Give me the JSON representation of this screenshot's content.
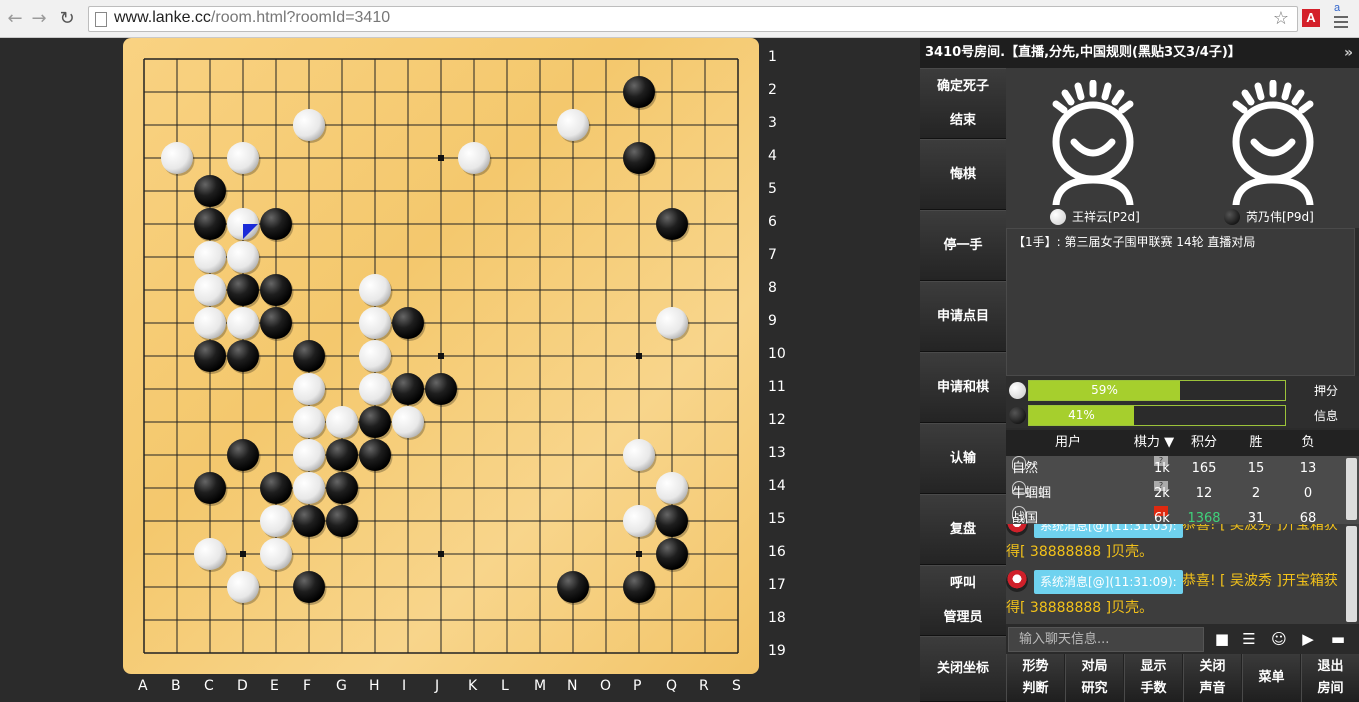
{
  "browser": {
    "url_host": "www.lanke.cc",
    "url_path": "/room.html?roomId=3410"
  },
  "room_title": "3410号房间.【直播,分先,中国规则(黑贴3又3/4子)】",
  "board": {
    "size": 19,
    "columns": [
      "A",
      "B",
      "C",
      "D",
      "E",
      "F",
      "G",
      "H",
      "I",
      "J",
      "K",
      "L",
      "M",
      "N",
      "O",
      "P",
      "Q",
      "R",
      "S"
    ],
    "rows": [
      "1",
      "2",
      "3",
      "4",
      "5",
      "6",
      "7",
      "8",
      "9",
      "10",
      "11",
      "12",
      "13",
      "14",
      "15",
      "16",
      "17",
      "18",
      "19"
    ],
    "star_points": [
      [
        3,
        3
      ],
      [
        9,
        3
      ],
      [
        15,
        3
      ],
      [
        3,
        9
      ],
      [
        9,
        9
      ],
      [
        15,
        9
      ],
      [
        3,
        15
      ],
      [
        9,
        15
      ],
      [
        15,
        15
      ]
    ],
    "last_move": [
      3,
      5
    ],
    "stones": [
      {
        "c": 15,
        "r": 1,
        "color": "black"
      },
      {
        "c": 5,
        "r": 2,
        "color": "white"
      },
      {
        "c": 13,
        "r": 2,
        "color": "white"
      },
      {
        "c": 1,
        "r": 3,
        "color": "white"
      },
      {
        "c": 3,
        "r": 3,
        "color": "white"
      },
      {
        "c": 10,
        "r": 3,
        "color": "white"
      },
      {
        "c": 15,
        "r": 3,
        "color": "black"
      },
      {
        "c": 2,
        "r": 4,
        "color": "black"
      },
      {
        "c": 2,
        "r": 5,
        "color": "black"
      },
      {
        "c": 3,
        "r": 5,
        "color": "white"
      },
      {
        "c": 4,
        "r": 5,
        "color": "black"
      },
      {
        "c": 16,
        "r": 5,
        "color": "black"
      },
      {
        "c": 2,
        "r": 6,
        "color": "white"
      },
      {
        "c": 3,
        "r": 6,
        "color": "white"
      },
      {
        "c": 2,
        "r": 7,
        "color": "white"
      },
      {
        "c": 3,
        "r": 7,
        "color": "black"
      },
      {
        "c": 4,
        "r": 7,
        "color": "black"
      },
      {
        "c": 7,
        "r": 7,
        "color": "white"
      },
      {
        "c": 2,
        "r": 8,
        "color": "white"
      },
      {
        "c": 3,
        "r": 8,
        "color": "white"
      },
      {
        "c": 4,
        "r": 8,
        "color": "black"
      },
      {
        "c": 7,
        "r": 8,
        "color": "white"
      },
      {
        "c": 8,
        "r": 8,
        "color": "black"
      },
      {
        "c": 16,
        "r": 8,
        "color": "white"
      },
      {
        "c": 2,
        "r": 9,
        "color": "black"
      },
      {
        "c": 3,
        "r": 9,
        "color": "black"
      },
      {
        "c": 5,
        "r": 9,
        "color": "black"
      },
      {
        "c": 7,
        "r": 9,
        "color": "white"
      },
      {
        "c": 5,
        "r": 10,
        "color": "white"
      },
      {
        "c": 7,
        "r": 10,
        "color": "white"
      },
      {
        "c": 8,
        "r": 10,
        "color": "black"
      },
      {
        "c": 9,
        "r": 10,
        "color": "black"
      },
      {
        "c": 5,
        "r": 11,
        "color": "white"
      },
      {
        "c": 6,
        "r": 11,
        "color": "white"
      },
      {
        "c": 7,
        "r": 11,
        "color": "black"
      },
      {
        "c": 8,
        "r": 11,
        "color": "white"
      },
      {
        "c": 3,
        "r": 12,
        "color": "black"
      },
      {
        "c": 5,
        "r": 12,
        "color": "white"
      },
      {
        "c": 6,
        "r": 12,
        "color": "black"
      },
      {
        "c": 7,
        "r": 12,
        "color": "black"
      },
      {
        "c": 15,
        "r": 12,
        "color": "white"
      },
      {
        "c": 2,
        "r": 13,
        "color": "black"
      },
      {
        "c": 4,
        "r": 13,
        "color": "black"
      },
      {
        "c": 5,
        "r": 13,
        "color": "white"
      },
      {
        "c": 6,
        "r": 13,
        "color": "black"
      },
      {
        "c": 16,
        "r": 13,
        "color": "white"
      },
      {
        "c": 4,
        "r": 14,
        "color": "white"
      },
      {
        "c": 5,
        "r": 14,
        "color": "black"
      },
      {
        "c": 6,
        "r": 14,
        "color": "black"
      },
      {
        "c": 15,
        "r": 14,
        "color": "white"
      },
      {
        "c": 16,
        "r": 14,
        "color": "black"
      },
      {
        "c": 2,
        "r": 15,
        "color": "white"
      },
      {
        "c": 4,
        "r": 15,
        "color": "white"
      },
      {
        "c": 16,
        "r": 15,
        "color": "black"
      },
      {
        "c": 3,
        "r": 16,
        "color": "white"
      },
      {
        "c": 5,
        "r": 16,
        "color": "black"
      },
      {
        "c": 13,
        "r": 16,
        "color": "black"
      },
      {
        "c": 15,
        "r": 16,
        "color": "black"
      }
    ]
  },
  "side_menu": [
    {
      "l1": "确定死子",
      "l2": "结束"
    },
    {
      "l1": "悔棋",
      "l2": ""
    },
    {
      "l1": "停一手",
      "l2": ""
    },
    {
      "l1": "申请点目",
      "l2": ""
    },
    {
      "l1": "申请和棋",
      "l2": ""
    },
    {
      "l1": "认输",
      "l2": ""
    },
    {
      "l1": "复盘",
      "l2": ""
    },
    {
      "l1": "呼叫",
      "l2": "管理员"
    },
    {
      "l1": "关闭坐标",
      "l2": ""
    }
  ],
  "players": {
    "white": {
      "name": "王祥云[P2d]"
    },
    "black": {
      "name": "芮乃伟[P9d]"
    }
  },
  "info_text": "【1手】: 第三届女子围甲联赛 14轮 直播对局",
  "progress": {
    "white": {
      "value": 0.59,
      "label": "59%",
      "side_label": "押分"
    },
    "black": {
      "value": 0.41,
      "label": "41%",
      "side_label": "信息"
    }
  },
  "user_table": {
    "headers": {
      "user": "用户",
      "rank": "棋力",
      "score": "积分",
      "win": "胜",
      "loss": "负"
    },
    "rows": [
      {
        "user": "自然",
        "rank": "1k",
        "score": "165",
        "win": "15",
        "loss": "13"
      },
      {
        "user": "牛蝈蝈",
        "rank": "2k",
        "score": "12",
        "win": "2",
        "loss": "0"
      },
      {
        "user": "战国",
        "rank": "6k",
        "score": "1368",
        "win": "31",
        "loss": "68"
      }
    ]
  },
  "chat": {
    "messages": [
      {
        "tag": "系统消息[@](11:31:03):",
        "text1": "恭喜! [ 吴波秀 ]开宝箱获",
        "text2": "得[ 38888888 ]贝壳。"
      },
      {
        "tag": "系统消息[@](11:31:09):",
        "text1": "恭喜! [ 吴波秀 ]开宝箱获",
        "text2": "得[ 38888888 ]贝壳。"
      }
    ],
    "input_placeholder": "输入聊天信息..."
  },
  "bottom_buttons": [
    {
      "l1": "形势",
      "l2": "判断"
    },
    {
      "l1": "对局",
      "l2": "研究"
    },
    {
      "l1": "显示",
      "l2": "手数"
    },
    {
      "l1": "关闭",
      "l2": "声音"
    },
    {
      "l1": "菜单",
      "l2": ""
    },
    {
      "l1": "退出",
      "l2": "房间"
    }
  ],
  "colors": {
    "board": "#f6cc77",
    "progress": "#a6cf2d",
    "chat_text": "#f3c21a",
    "chat_tag": "#6fd2ef"
  }
}
